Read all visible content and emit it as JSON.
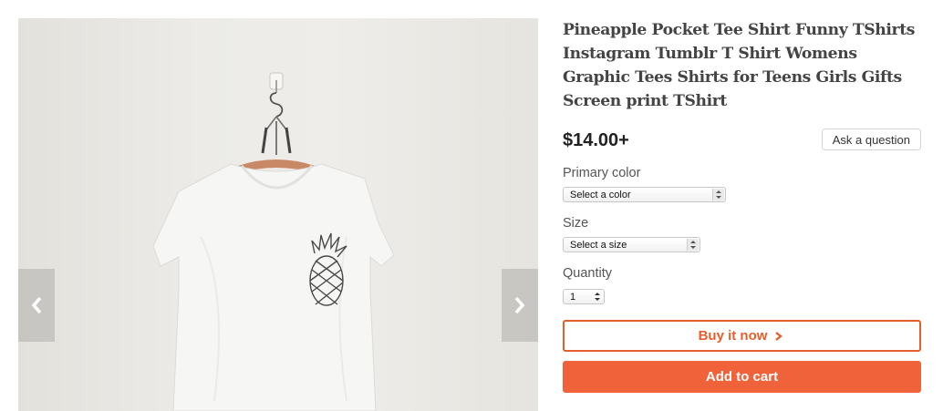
{
  "product": {
    "title": "Pineapple Pocket Tee Shirt Funny TShirts Instagram Tumblr T Shirt Womens Graphic Tees Shirts for Teens Girls Gifts Screen print TShirt",
    "price": "$14.00+"
  },
  "ask_question_label": "Ask a question",
  "options": {
    "color": {
      "label": "Primary color",
      "selected": "Select a color"
    },
    "size": {
      "label": "Size",
      "selected": "Select a size"
    },
    "quantity": {
      "label": "Quantity",
      "selected": "1"
    }
  },
  "buttons": {
    "buy_now": "Buy it now",
    "add_to_cart": "Add to cart"
  },
  "icons": {
    "prev": "chevron-left-icon",
    "next": "chevron-right-icon",
    "buy_arrow": "chevron-right-icon",
    "select_arrows": "updown-arrows-icon"
  },
  "colors": {
    "accent": "#f0623a",
    "accent_border": "#e35f2d",
    "title": "#444444"
  }
}
